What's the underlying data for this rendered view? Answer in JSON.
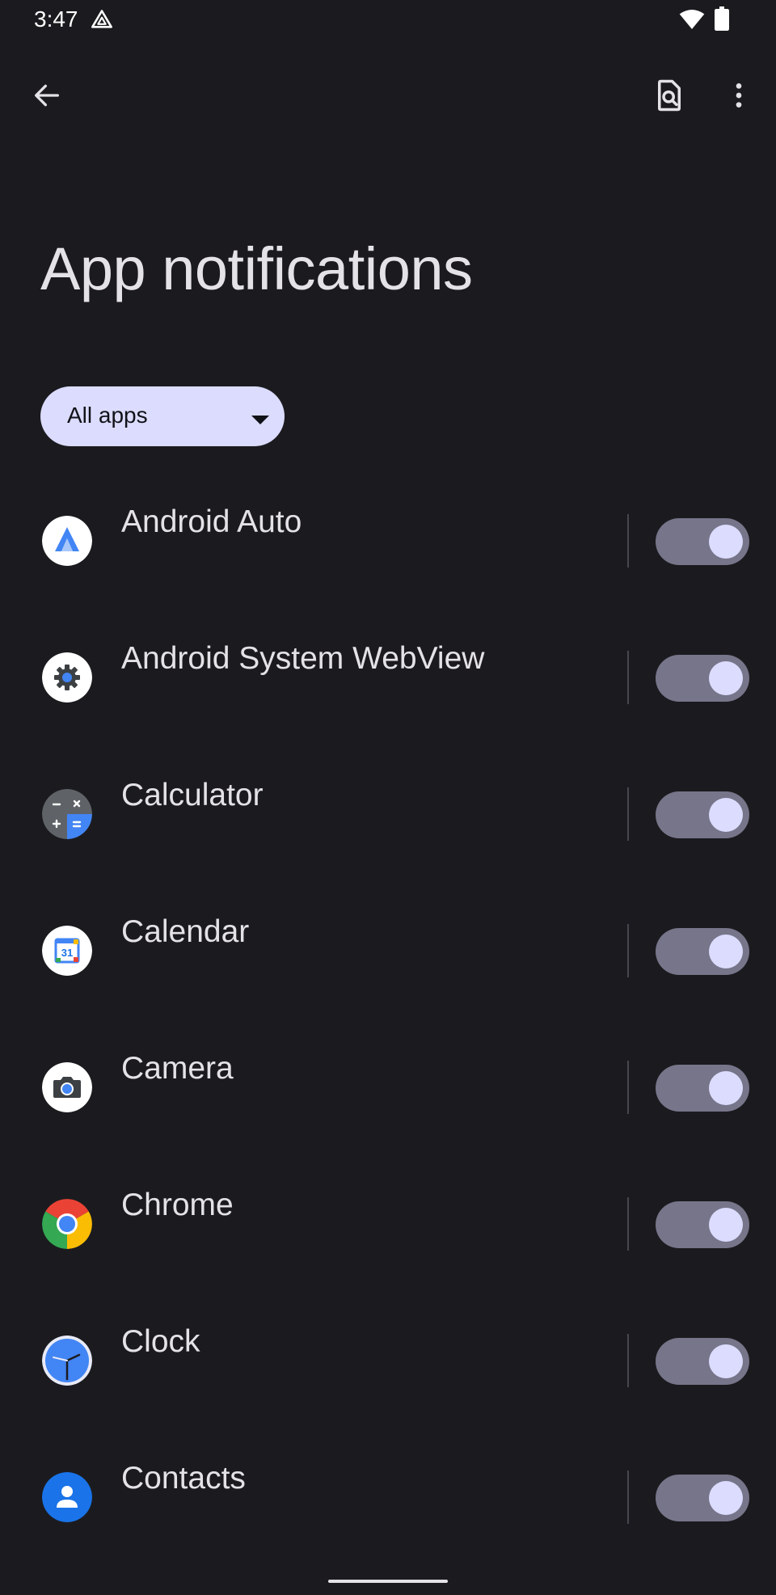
{
  "status_bar": {
    "time": "3:47",
    "icons": [
      "drive-icon",
      "wifi-icon",
      "battery-icon"
    ]
  },
  "top_bar": {
    "back_icon": "arrow-back-icon",
    "search_icon": "search-settings-icon",
    "more_icon": "more-vert-icon"
  },
  "page": {
    "title": "App notifications"
  },
  "filter": {
    "selected": "All apps"
  },
  "apps": [
    {
      "name": "Android Auto",
      "icon": "android-auto-icon",
      "enabled": true
    },
    {
      "name": "Android System WebView",
      "icon": "webview-icon",
      "enabled": true
    },
    {
      "name": "Calculator",
      "icon": "calculator-icon",
      "enabled": true
    },
    {
      "name": "Calendar",
      "icon": "calendar-icon",
      "enabled": true
    },
    {
      "name": "Camera",
      "icon": "camera-icon",
      "enabled": true
    },
    {
      "name": "Chrome",
      "icon": "chrome-icon",
      "enabled": true
    },
    {
      "name": "Clock",
      "icon": "clock-icon",
      "enabled": true
    },
    {
      "name": "Contacts",
      "icon": "contacts-icon",
      "enabled": true
    }
  ],
  "calendar_icon_day": "31",
  "colors": {
    "background": "#1b1b1f",
    "chip": "#dcdcff",
    "toggle_track": "#76758a",
    "toggle_thumb": "#dcdcff"
  }
}
